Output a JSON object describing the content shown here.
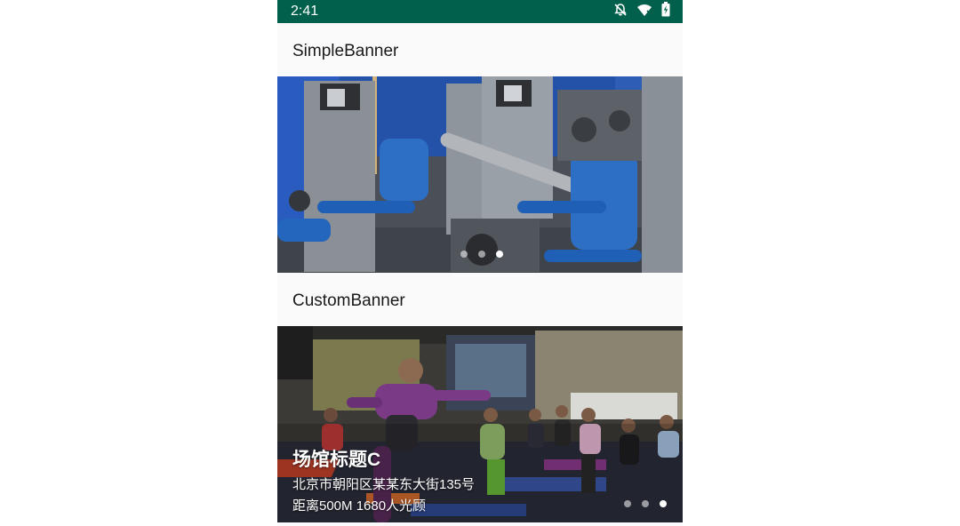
{
  "status_bar": {
    "time": "2:41",
    "icons": [
      "notifications-off-icon",
      "wifi-icon",
      "battery-charging-icon"
    ],
    "color": "#00604c"
  },
  "simple_banner": {
    "title": "SimpleBanner",
    "image": "gym-equipment-photo",
    "page_count": 3,
    "active_index": 2
  },
  "custom_banner": {
    "title": "CustomBanner",
    "image": "yoga-class-photo",
    "venue_title": "场馆标题C",
    "address": "北京市朝阳区某某东大街135号",
    "distance_info": "距离500M 1680人光顾",
    "page_count": 3,
    "active_index": 2
  }
}
